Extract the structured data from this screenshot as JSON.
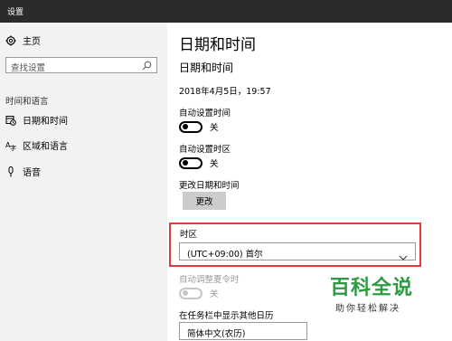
{
  "window": {
    "title": "设置"
  },
  "sidebar": {
    "home_label": "主页",
    "search_placeholder": "查找设置",
    "section_label": "时间和语言",
    "items": [
      {
        "label": "日期和时间",
        "icon": "calendar-clock-icon"
      },
      {
        "label": "区域和语言",
        "icon": "language-icon"
      },
      {
        "label": "语音",
        "icon": "microphone-icon"
      }
    ]
  },
  "main": {
    "page_title": "日期和时间",
    "sub_title": "日期和时间",
    "current_datetime": "2018年4月5日，19:57",
    "auto_time": {
      "label": "自动设置时间",
      "state": "关"
    },
    "auto_timezone": {
      "label": "自动设置时区",
      "state": "关"
    },
    "change_datetime": {
      "label": "更改日期和时间",
      "button": "更改"
    },
    "timezone": {
      "label": "时区",
      "value": "(UTC+09:00) 首尔"
    },
    "dst": {
      "label": "自动调整夏令时",
      "state": "关"
    },
    "calendar": {
      "label": "在任务栏中显示其他日历",
      "value": "简体中文(农历)"
    }
  },
  "watermark": {
    "title": "百科全说",
    "subtitle": "助你轻松解决"
  },
  "colors": {
    "titlebar": "#2b2b2b",
    "sidebar": "#f2f2f2",
    "highlight": "#e23b3b",
    "watermark": "#2f9a44"
  }
}
